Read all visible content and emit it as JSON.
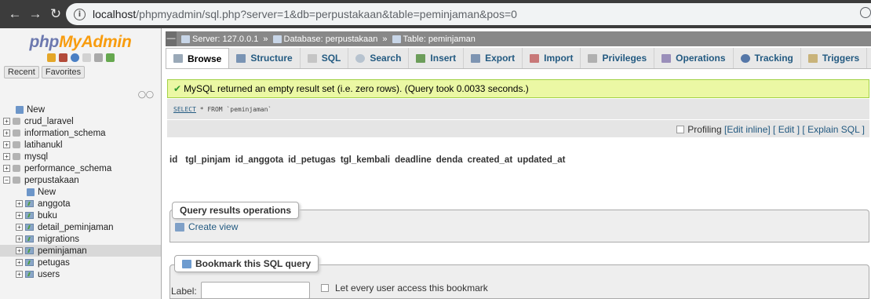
{
  "browser": {
    "url_host": "localhost",
    "url_path": "/phpmyadmin/sql.php?server=1&db=perpustakaan&table=peminjaman&pos=0"
  },
  "logo": {
    "part1": "php",
    "part2": "MyAdmin"
  },
  "nav": {
    "recent": "Recent",
    "favorites": "Favorites"
  },
  "tree": {
    "new": "New",
    "databases": [
      "crud_laravel",
      "information_schema",
      "latihanukl",
      "mysql",
      "performance_schema",
      "perpustakaan"
    ],
    "tables": [
      "anggota",
      "buku",
      "detail_peminjaman",
      "migrations",
      "peminjaman",
      "petugas",
      "users"
    ]
  },
  "breadcrumb": {
    "server": "Server: 127.0.0.1",
    "database": "Database: perpustakaan",
    "table": "Table: peminjaman"
  },
  "tabs": [
    "Browse",
    "Structure",
    "SQL",
    "Search",
    "Insert",
    "Export",
    "Import",
    "Privileges",
    "Operations",
    "Tracking",
    "Triggers"
  ],
  "message": "MySQL returned an empty result set (i.e. zero rows). (Query took 0.0033 seconds.)",
  "sql": {
    "select": "SELECT",
    "rest": " * FROM `peminjaman`"
  },
  "profiling": {
    "label": "Profiling",
    "edit_inline": "[Edit inline]",
    "edit": "[ Edit ]",
    "explain": "[ Explain SQL ]"
  },
  "columns": [
    "id",
    "tgl_pinjam",
    "id_anggota",
    "id_petugas",
    "tgl_kembali",
    "deadline",
    "denda",
    "created_at",
    "updated_at"
  ],
  "query_ops": {
    "title": "Query results operations",
    "create_view": "Create view"
  },
  "bookmark": {
    "title": "Bookmark this SQL query",
    "label": "Label:",
    "every_user": "Let every user access this bookmark"
  }
}
